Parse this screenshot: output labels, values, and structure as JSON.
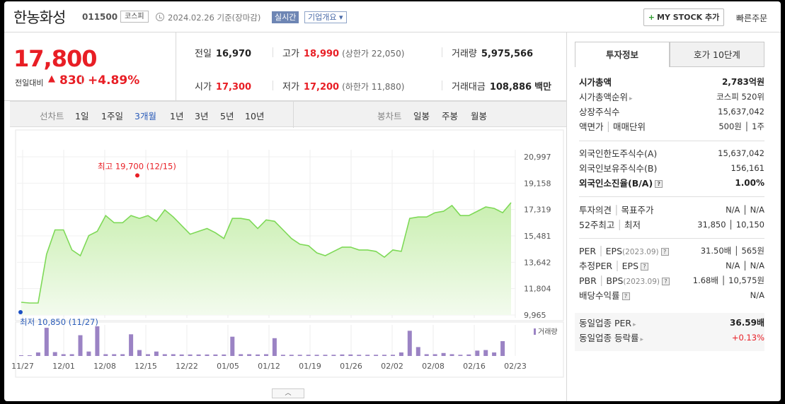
{
  "header": {
    "company_name": "한농화성",
    "code": "011500",
    "market": "코스피",
    "date": "2024.02.26 기준(장마감)",
    "realtime_label": "실시간",
    "profile_label": "기업개요 ▾",
    "mystock_label": "MY STOCK 추가",
    "quick_order_label": "빠른주문"
  },
  "price": {
    "current": "17,800",
    "change_label": "전일대비",
    "change": "830",
    "change_pct": "+4.89%"
  },
  "quotes": {
    "prev_label": "전일",
    "prev": "16,970",
    "high_label": "고가",
    "high": "18,990",
    "upper_limit": "(상한가 22,050)",
    "volume_label": "거래량",
    "volume": "5,975,566",
    "open_label": "시가",
    "open": "17,300",
    "low_label": "저가",
    "low": "17,200",
    "lower_limit": "(하한가 11,880)",
    "amount_label": "거래대금",
    "amount": "108,886",
    "amount_unit": "백만"
  },
  "chart_toolbar": {
    "line_chart_label": "선차트",
    "periods": [
      "1일",
      "1주일",
      "3개월",
      "1년",
      "3년",
      "5년",
      "10년"
    ],
    "selected_period": "3개월",
    "candle_chart_label": "봉차트",
    "candle_periods": [
      "일봉",
      "주봉",
      "월봉"
    ]
  },
  "chart_data": {
    "type": "area",
    "ylim": [
      9965,
      20997
    ],
    "y_ticks": [
      "20,997",
      "19,158",
      "17,319",
      "15,481",
      "13,642",
      "11,804",
      "9,965"
    ],
    "x_tick_labels": [
      "11/27",
      "12/01",
      "12/08",
      "12/15",
      "12/22",
      "01/05",
      "01/12",
      "01/19",
      "01/26",
      "02/02",
      "02/08",
      "02/16",
      "02/23"
    ],
    "max_annotation": "최고 19,700 (12/15)",
    "min_annotation": "최저 10,850 (11/27)",
    "volume_legend": "거래량",
    "price_series": [
      10850,
      10800,
      10800,
      14200,
      15900,
      15900,
      14500,
      14100,
      15500,
      15800,
      16900,
      16400,
      16400,
      16900,
      16700,
      16900,
      16500,
      17300,
      16800,
      16200,
      15600,
      15800,
      16000,
      15700,
      15300,
      16700,
      16700,
      16600,
      16000,
      16600,
      16500,
      15900,
      15300,
      14900,
      14800,
      14300,
      14100,
      14400,
      14700,
      14700,
      14500,
      14500,
      14400,
      14000,
      14500,
      14400,
      16700,
      16800,
      16800,
      17100,
      17200,
      17600,
      16900,
      16900,
      17200,
      17500,
      17400,
      17100,
      17800
    ],
    "volume_series": [
      0,
      0,
      0.12,
      0.95,
      0.13,
      0.06,
      0.06,
      0.7,
      0.15,
      1.0,
      0.06,
      0.06,
      0.06,
      0.73,
      0.2,
      0.06,
      0.15,
      0.06,
      0.06,
      0.05,
      0.05,
      0.05,
      0.05,
      0.05,
      0.05,
      0.65,
      0.06,
      0.06,
      0.05,
      0.06,
      0.6,
      0.04,
      0.04,
      0.04,
      0.04,
      0.04,
      0.04,
      0.04,
      0.05,
      0.05,
      0.04,
      0.04,
      0.04,
      0.04,
      0.04,
      0.12,
      0.85,
      0.3,
      0.06,
      0.06,
      0.1,
      0.06,
      0.04,
      0.05,
      0.18,
      0.2,
      0.12,
      0.5
    ]
  },
  "right_panel": {
    "tab_info": "투자정보",
    "tab_orderbook": "호가 10단계",
    "market_cap_label": "시가총액",
    "market_cap": "2,783억원",
    "cap_rank_label": "시가총액순위",
    "cap_rank": "코스피 520위",
    "shares_label": "상장주식수",
    "shares": "15,637,042",
    "par_label": "액면가",
    "unit_label": "매매단위",
    "par_unit": "500원 │ 1주",
    "foreign_limit_label": "외국인한도주식수(A)",
    "foreign_limit": "15,637,042",
    "foreign_hold_label": "외국인보유주식수(B)",
    "foreign_hold": "156,161",
    "foreign_ratio_label": "외국인소진율(B/A)",
    "foreign_ratio": "1.00%",
    "opinion_label": "투자의견",
    "target_label": "목표주가",
    "opinion_target": "N/A │ N/A",
    "week52_label": "52주최고",
    "week52_low_label": "최저",
    "week52": "31,850 │ 10,150",
    "per_label": "PER",
    "eps_label": "EPS",
    "per_period": "(2023.09)",
    "per_eps": "31.50배 │ 565원",
    "est_per_label": "추정PER",
    "est_eps_label": "EPS",
    "est_per_eps": "N/A │ N/A",
    "pbr_label": "PBR",
    "bps_label": "BPS",
    "pbr_period": "(2023.09)",
    "pbr_bps": "1.68배 │ 10,575원",
    "dividend_label": "배당수익률",
    "dividend": "N/A",
    "industry_per_label": "동일업종 PER",
    "industry_per": "36.59배",
    "industry_change_label": "동일업종 등락률",
    "industry_change": "+0.13%"
  },
  "colors": {
    "up": "#e81e25",
    "area_line": "#7ed957",
    "area_fill": "#dff5cf",
    "volume": "#9b83c4",
    "max_marker": "#e81e25",
    "min_marker": "#1a4fc4"
  }
}
